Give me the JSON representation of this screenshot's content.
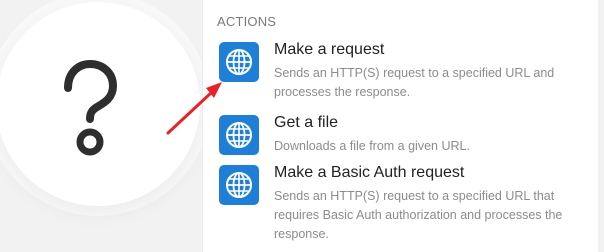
{
  "panel": {
    "section_title": "ACTIONS",
    "actions": [
      {
        "title": "Make a request",
        "description": "Sends an HTTP(S) request to a specified URL and processes the response.",
        "icon": "globe-icon"
      },
      {
        "title": "Get a file",
        "description": "Downloads a file from a given URL.",
        "icon": "globe-icon"
      },
      {
        "title": "Make a Basic Auth request",
        "description": "Sends an HTTP(S) request to a specified URL that requires Basic Auth authorization and processes the response.",
        "icon": "globe-icon"
      }
    ]
  },
  "module": {
    "icon": "question-mark-icon"
  },
  "annotation": {
    "icon": "red-arrow-icon",
    "color": "#e8212a"
  },
  "colors": {
    "accent": "#1f7fd6",
    "title_text": "#222222",
    "description_text": "#8c8c8c"
  }
}
